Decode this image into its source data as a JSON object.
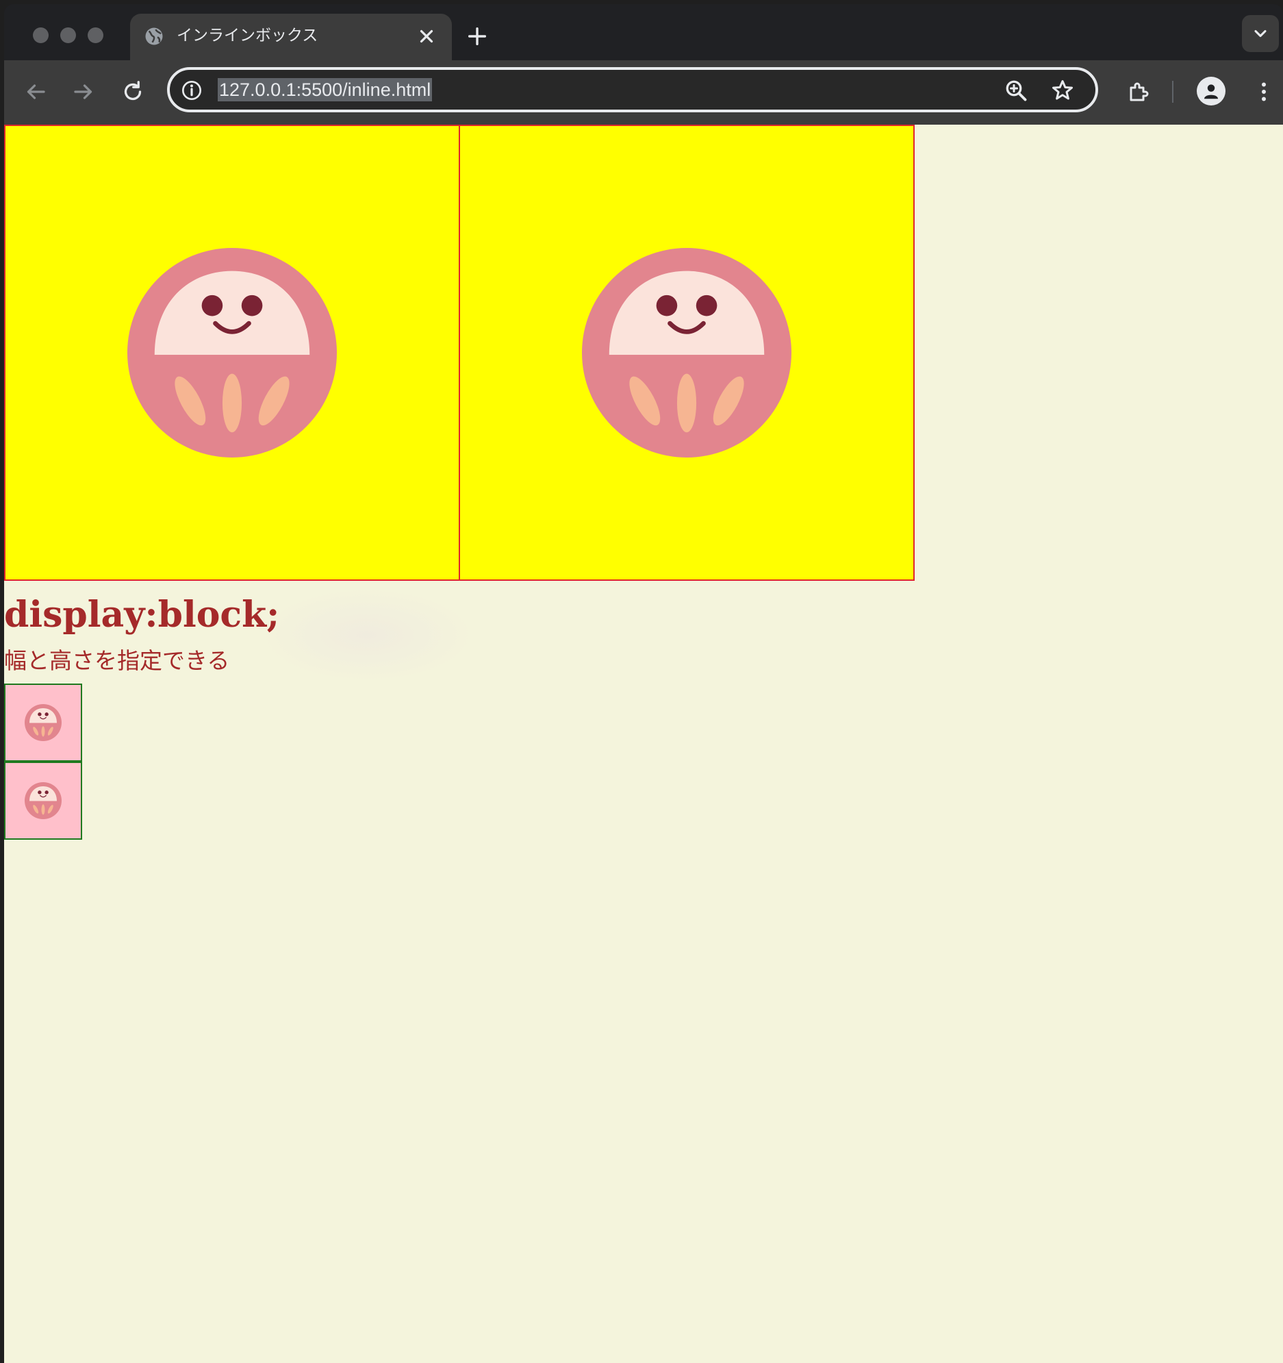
{
  "browser": {
    "tab_title": "インラインボックス",
    "url": "127.0.0.1:5500/inline.html"
  },
  "page": {
    "heading": "display:block;",
    "subtext": "幅と高さを指定できる",
    "large_images": [
      {
        "alt": "daruma"
      },
      {
        "alt": "daruma"
      }
    ],
    "small_images": [
      {
        "alt": "daruma"
      },
      {
        "alt": "daruma"
      }
    ]
  },
  "colors": {
    "page_background": "#f4f4dc",
    "large_box_background": "#ffff00",
    "large_box_border": "#e0262b",
    "small_box_background": "#ffc0cb",
    "small_box_border": "#1f7a1f",
    "text": "#a52a2a",
    "daruma_body": "#e2858e",
    "daruma_face": "#fbe3db",
    "daruma_eye": "#7a2334",
    "daruma_pattern": "#f6b592"
  }
}
